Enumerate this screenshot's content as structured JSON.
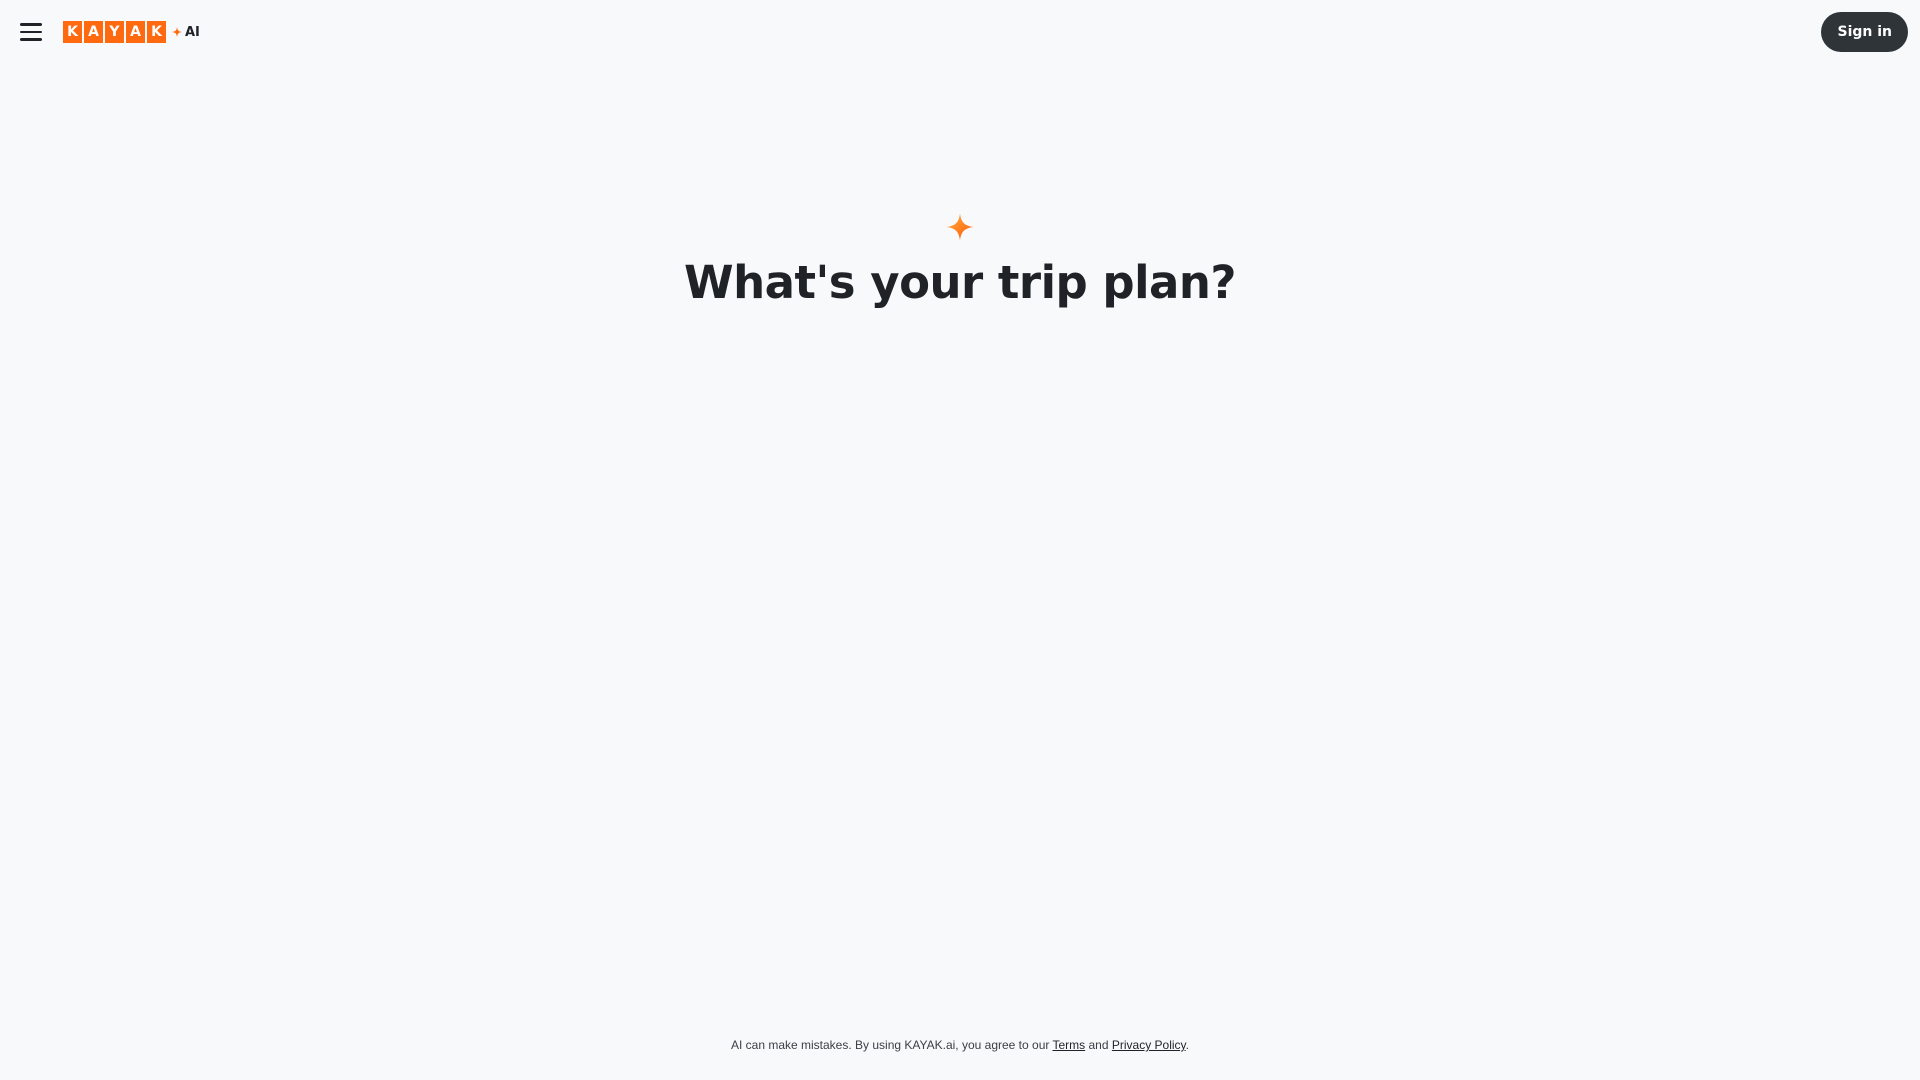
{
  "header": {
    "menu_icon": "hamburger-menu-icon",
    "logo_letters": [
      "K",
      "A",
      "Y",
      "A",
      "K"
    ],
    "logo_suffix": "AI",
    "sign_in_label": "Sign in"
  },
  "hero": {
    "icon": "sparkle-icon",
    "title": "What's your trip plan?"
  },
  "footer": {
    "disclaimer_prefix": "AI can make mistakes. By using KAYAK.ai, you agree to our",
    "terms_label": "Terms",
    "and_text": "and",
    "privacy_label": "Privacy Policy",
    "end_punct": "."
  },
  "colors": {
    "brand_orange": "#ff690f",
    "background": "#f8f9fb",
    "button_dark": "#2f3439",
    "text": "#1f2328"
  }
}
